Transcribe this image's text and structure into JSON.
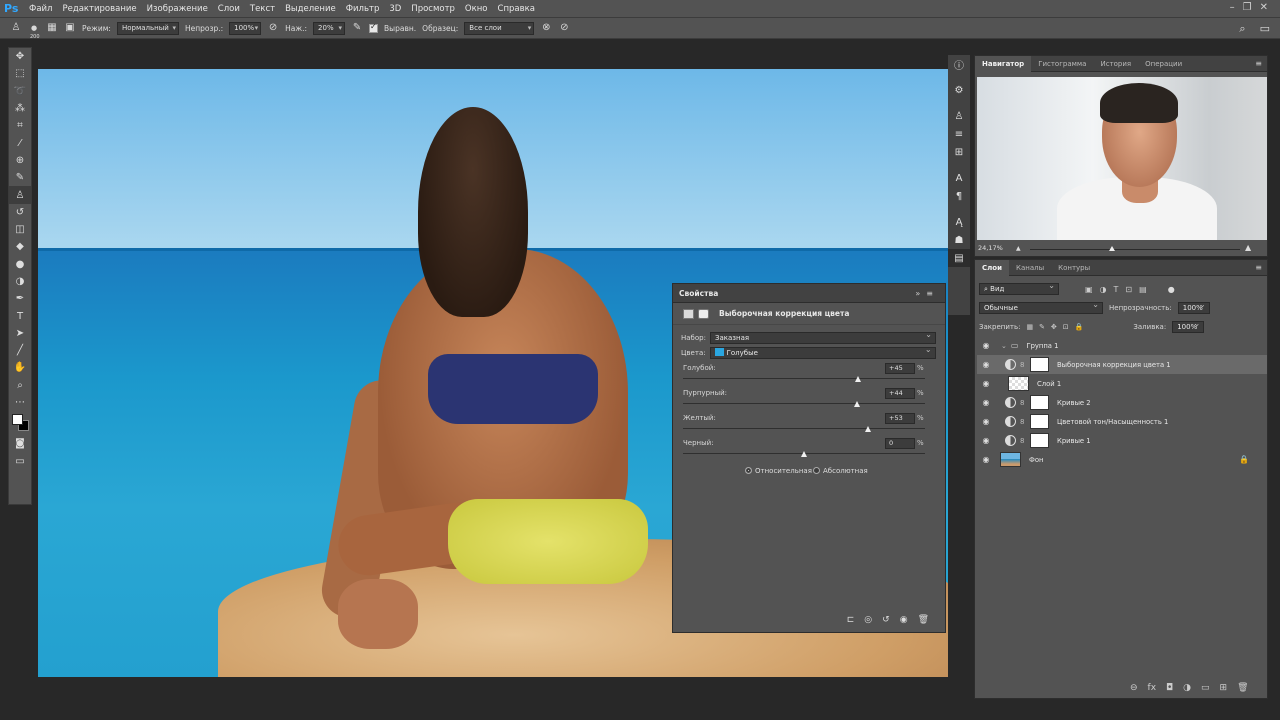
{
  "app": {
    "logo": "Ps",
    "menu": [
      "Файл",
      "Редактирование",
      "Изображение",
      "Слои",
      "Текст",
      "Выделение",
      "Фильтр",
      "3D",
      "Просмотр",
      "Окно",
      "Справка"
    ]
  },
  "options": {
    "brush_size": "200",
    "mode_label": "Режим:",
    "mode_value": "Нормальный",
    "opacity_label": "Непрозр.:",
    "opacity_value": "100%",
    "pressure_label": "Наж.:",
    "pressure_value": "20%",
    "aligned_label": "Выравн.",
    "sample_label": "Образец:",
    "sample_value": "Все слои"
  },
  "properties": {
    "title": "Свойства",
    "subtitle": "Выборочная коррекция цвета",
    "preset_label": "Набор:",
    "preset_value": "Заказная",
    "colors_label": "Цвета:",
    "colors_value": "Голубые",
    "sliders": [
      {
        "label": "Голубой:",
        "value": "+45",
        "fraction": 0.725
      },
      {
        "label": "Пурпурный:",
        "value": "+44",
        "fraction": 0.72
      },
      {
        "label": "Желтый:",
        "value": "+53",
        "fraction": 0.765
      },
      {
        "label": "Черный:",
        "value": "0",
        "fraction": 0.5
      }
    ],
    "pct": "%",
    "method_relative": "Относительная",
    "method_absolute": "Абсолютная",
    "method_selected": "relative"
  },
  "navigator": {
    "tabs": [
      "Навигатор",
      "Гистограмма",
      "История",
      "Операции"
    ],
    "zoom": "24,17%",
    "zoom_fraction": 0.39
  },
  "layers": {
    "tabs": [
      "Слои",
      "Каналы",
      "Контуры"
    ],
    "filter_value": "Вид",
    "blend_value": "Обычные",
    "opacity_label": "Непрозрачность:",
    "opacity_value": "100%",
    "lock_label": "Закрепить:",
    "fill_label": "Заливка:",
    "fill_value": "100%",
    "items": [
      {
        "name": "Группа 1",
        "kind": "group"
      },
      {
        "name": "Выборочная коррекция цвета 1",
        "kind": "adjustment",
        "selected": true
      },
      {
        "name": "Слой 1",
        "kind": "pixel"
      },
      {
        "name": "Кривые 2",
        "kind": "adjustment"
      },
      {
        "name": "Цветовой тон/Насыщенность 1",
        "kind": "adjustment"
      },
      {
        "name": "Кривые 1",
        "kind": "adjustment"
      },
      {
        "name": "Фон",
        "kind": "background"
      }
    ]
  }
}
